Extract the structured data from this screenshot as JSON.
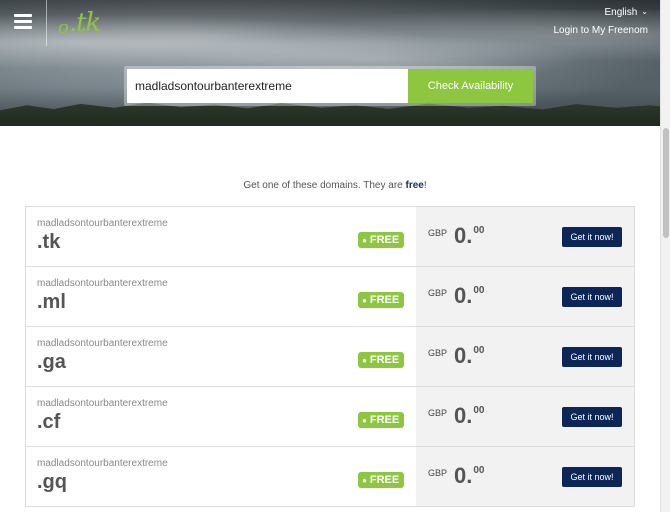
{
  "header": {
    "logo_text": ".tk",
    "language": "English",
    "login": "Login to My Freenom"
  },
  "search": {
    "value": "madladsontourbanterextreme",
    "button_label": "Check Availability"
  },
  "intro": {
    "prefix": "Get one of these domains. They are ",
    "highlight": "free",
    "suffix": "!"
  },
  "results": [
    {
      "name": "madladsontourbanterextreme",
      "tld": ".tk",
      "badge": "FREE",
      "currency": "GBP",
      "price_main": "0.",
      "price_cents": "00",
      "button": "Get it now!"
    },
    {
      "name": "madladsontourbanterextreme",
      "tld": ".ml",
      "badge": "FREE",
      "currency": "GBP",
      "price_main": "0.",
      "price_cents": "00",
      "button": "Get it now!"
    },
    {
      "name": "madladsontourbanterextreme",
      "tld": ".ga",
      "badge": "FREE",
      "currency": "GBP",
      "price_main": "0.",
      "price_cents": "00",
      "button": "Get it now!"
    },
    {
      "name": "madladsontourbanterextreme",
      "tld": ".cf",
      "badge": "FREE",
      "currency": "GBP",
      "price_main": "0.",
      "price_cents": "00",
      "button": "Get it now!"
    },
    {
      "name": "madladsontourbanterextreme",
      "tld": ".gq",
      "badge": "FREE",
      "currency": "GBP",
      "price_main": "0.",
      "price_cents": "00",
      "button": "Get it now!"
    }
  ],
  "colors": {
    "accent_green": "#8dc63f",
    "button_navy": "#0b2657"
  },
  "icons": {
    "menu": "hamburger-icon",
    "language_dropdown": "chevron-down-icon"
  }
}
